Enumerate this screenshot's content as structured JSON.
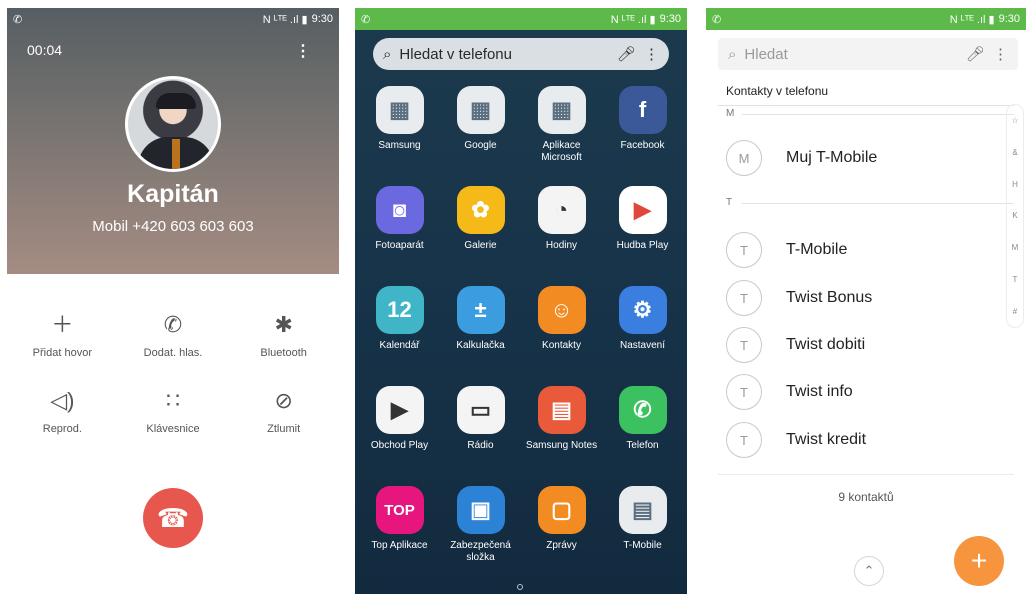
{
  "status": {
    "time": "9:30",
    "icons": "N ᴸᵀᴱ .ıl ▮"
  },
  "call": {
    "timer": "00:04",
    "name": "Kapitán",
    "number": "Mobil  +420 603 603 603",
    "actions": [
      {
        "label": "Přidat hovor",
        "icon": "plus-icon"
      },
      {
        "label": "Dodat. hlas.",
        "icon": "volume-boost-icon"
      },
      {
        "label": "Bluetooth",
        "icon": "bluetooth-icon"
      },
      {
        "label": "Reprod.",
        "icon": "speaker-icon"
      },
      {
        "label": "Klávesnice",
        "icon": "keypad-icon"
      },
      {
        "label": "Ztlumit",
        "icon": "mute-mic-icon"
      }
    ],
    "accent": "#e8574d"
  },
  "apps": {
    "search_placeholder": "Hledat v telefonu",
    "items": [
      {
        "label": "Samsung",
        "icon": "samsung-folder-icon",
        "color": "#e9ecef"
      },
      {
        "label": "Google",
        "icon": "google-folder-icon",
        "color": "#e9ecef"
      },
      {
        "label": "Aplikace Microsoft",
        "icon": "microsoft-folder-icon",
        "color": "#e9ecef"
      },
      {
        "label": "Facebook",
        "icon": "facebook-icon",
        "color": "#3b5998"
      },
      {
        "label": "Fotoaparát",
        "icon": "camera-icon",
        "color": "#6b69e0"
      },
      {
        "label": "Galerie",
        "icon": "gallery-icon",
        "color": "#f5b918"
      },
      {
        "label": "Hodiny",
        "icon": "clock-icon",
        "color": "#f4f4f4"
      },
      {
        "label": "Hudba Play",
        "icon": "play-music-icon",
        "color": "#ffffff"
      },
      {
        "label": "Kalendář",
        "icon": "calendar-icon",
        "color": "#3fb5c7"
      },
      {
        "label": "Kalkulačka",
        "icon": "calculator-icon",
        "color": "#3b9de0"
      },
      {
        "label": "Kontakty",
        "icon": "contacts-icon",
        "color": "#f28b22"
      },
      {
        "label": "Nastavení",
        "icon": "settings-icon",
        "color": "#3a7fe0"
      },
      {
        "label": "Obchod Play",
        "icon": "play-store-icon",
        "color": "#f4f4f4"
      },
      {
        "label": "Rádio",
        "icon": "radio-icon",
        "color": "#f4f4f4"
      },
      {
        "label": "Samsung Notes",
        "icon": "notes-icon",
        "color": "#e85a3a"
      },
      {
        "label": "Telefon",
        "icon": "phone-icon",
        "color": "#3cc161"
      },
      {
        "label": "Top Aplikace",
        "icon": "top-apps-icon",
        "color": "#e6167e"
      },
      {
        "label": "Zabezpečená složka",
        "icon": "secure-folder-icon",
        "color": "#2c83d6"
      },
      {
        "label": "Zprávy",
        "icon": "messages-icon",
        "color": "#f28b22"
      },
      {
        "label": "T-Mobile",
        "icon": "t-mobile-icon",
        "color": "#e9ecef"
      }
    ]
  },
  "contacts": {
    "search_placeholder": "Hledat",
    "section_title": "Kontakty v telefonu",
    "letter_m": "M",
    "letter_t": "T",
    "items": [
      {
        "initial": "M",
        "name": "Muj T-Mobile"
      },
      {
        "initial": "T",
        "name": "T-Mobile"
      },
      {
        "initial": "T",
        "name": "Twist Bonus"
      },
      {
        "initial": "T",
        "name": "Twist dobiti"
      },
      {
        "initial": "T",
        "name": "Twist info"
      },
      {
        "initial": "T",
        "name": "Twist kredit"
      }
    ],
    "index_letters": [
      "☆",
      "&",
      "H",
      "K",
      "M",
      "T",
      "#"
    ],
    "count": "9 kontaktů",
    "fab_color": "#f7943e"
  }
}
